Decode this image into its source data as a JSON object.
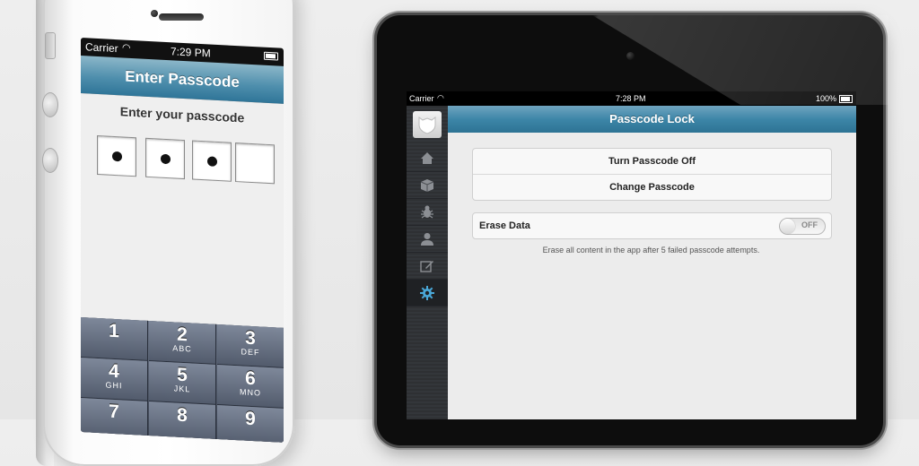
{
  "iphone": {
    "status": {
      "carrier": "Carrier",
      "time": "7:29 PM"
    },
    "navbar_title": "Enter Passcode",
    "prompt": "Enter your passcode",
    "pin": {
      "filled": 3,
      "total": 4
    },
    "keypad": [
      {
        "num": "1",
        "letters": ""
      },
      {
        "num": "2",
        "letters": "ABC"
      },
      {
        "num": "3",
        "letters": "DEF"
      },
      {
        "num": "4",
        "letters": "GHI"
      },
      {
        "num": "5",
        "letters": "JKL"
      },
      {
        "num": "6",
        "letters": "MNO"
      },
      {
        "num": "7",
        "letters": ""
      },
      {
        "num": "8",
        "letters": ""
      },
      {
        "num": "9",
        "letters": ""
      }
    ]
  },
  "ipad": {
    "status": {
      "carrier": "Carrier",
      "time": "7:28 PM",
      "battery": "100%"
    },
    "navbar_title": "Passcode Lock",
    "sidebar_icons": [
      "home-icon",
      "box-icon",
      "bug-icon",
      "user-icon",
      "edit-icon",
      "gear-icon"
    ],
    "sidebar_active": "gear-icon",
    "buttons": {
      "turn_off": "Turn Passcode Off",
      "change": "Change Passcode"
    },
    "erase": {
      "label": "Erase Data",
      "toggle_state": "OFF",
      "footnote": "Erase all content in the app after 5 failed passcode attempts."
    }
  },
  "colors": {
    "navbar_blue": "#3d86a8",
    "accent_active": "#4aa8d8"
  }
}
